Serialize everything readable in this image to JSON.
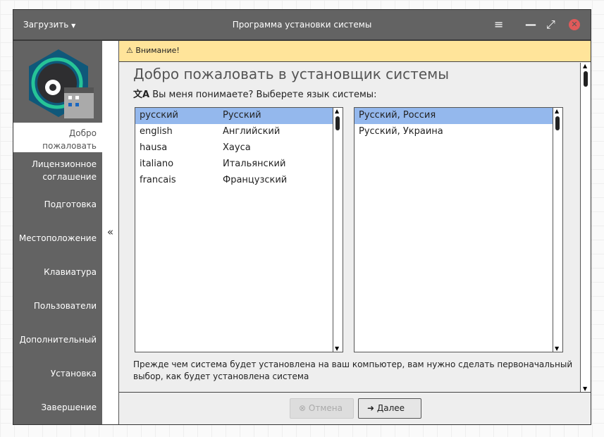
{
  "titlebar": {
    "load_label": "Загрузить",
    "title": "Программа установки системы"
  },
  "sidebar": {
    "items": [
      "Добро пожаловать",
      "Лицензионное соглашение",
      "Подготовка",
      "Местоположение",
      "Клавиатура",
      "Пользователи",
      "Дополнительный",
      "Установка",
      "Завершение"
    ],
    "collapse": "«"
  },
  "warning": "Внимание!",
  "main": {
    "heading": "Добро пожаловать в установщик системы",
    "question": "Вы меня понимаете? Выберете язык системы:",
    "languages": [
      {
        "native": "русский",
        "local": "Русский"
      },
      {
        "native": "english",
        "local": "Английский"
      },
      {
        "native": "hausa",
        "local": "Хауса"
      },
      {
        "native": "italiano",
        "local": "Итальянский"
      },
      {
        "native": "francais",
        "local": "Французский"
      }
    ],
    "locales": [
      "Русский, Россия",
      "Русский, Украина"
    ],
    "info": "Прежде чем система будет установлена на ваш компьютер, вам нужно сделать первоначальный выбор, как будет установлена система"
  },
  "footer": {
    "cancel": "Отмена",
    "next": "Далее"
  }
}
